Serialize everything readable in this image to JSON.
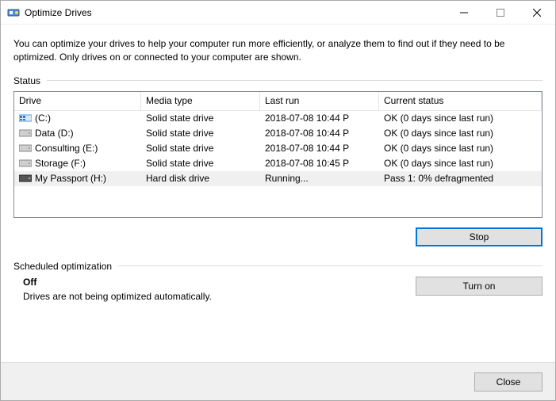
{
  "window": {
    "title": "Optimize Drives"
  },
  "intro": "You can optimize your drives to help your computer run more efficiently, or analyze them to find out if they need to be optimized. Only drives on or connected to your computer are shown.",
  "sections": {
    "status_label": "Status",
    "scheduled_label": "Scheduled optimization"
  },
  "columns": {
    "drive": "Drive",
    "media": "Media type",
    "last": "Last run",
    "status": "Current status"
  },
  "drives": [
    {
      "icon": "os",
      "name": "(C:)",
      "media": "Solid state drive",
      "last": "2018-07-08 10:44 P",
      "status": "OK (0 days since last run)",
      "selected": false
    },
    {
      "icon": "hdd",
      "name": "Data (D:)",
      "media": "Solid state drive",
      "last": "2018-07-08 10:44 P",
      "status": "OK (0 days since last run)",
      "selected": false
    },
    {
      "icon": "hdd",
      "name": "Consulting (E:)",
      "media": "Solid state drive",
      "last": "2018-07-08 10:44 P",
      "status": "OK (0 days since last run)",
      "selected": false
    },
    {
      "icon": "hdd",
      "name": "Storage (F:)",
      "media": "Solid state drive",
      "last": "2018-07-08 10:45 P",
      "status": "OK (0 days since last run)",
      "selected": false
    },
    {
      "icon": "ext",
      "name": "My Passport (H:)",
      "media": "Hard disk drive",
      "last": "Running...",
      "status": "Pass 1: 0% defragmented",
      "selected": true
    }
  ],
  "buttons": {
    "stop": "Stop",
    "turn_on": "Turn on",
    "close": "Close"
  },
  "scheduled": {
    "state": "Off",
    "desc": "Drives are not being optimized automatically."
  }
}
